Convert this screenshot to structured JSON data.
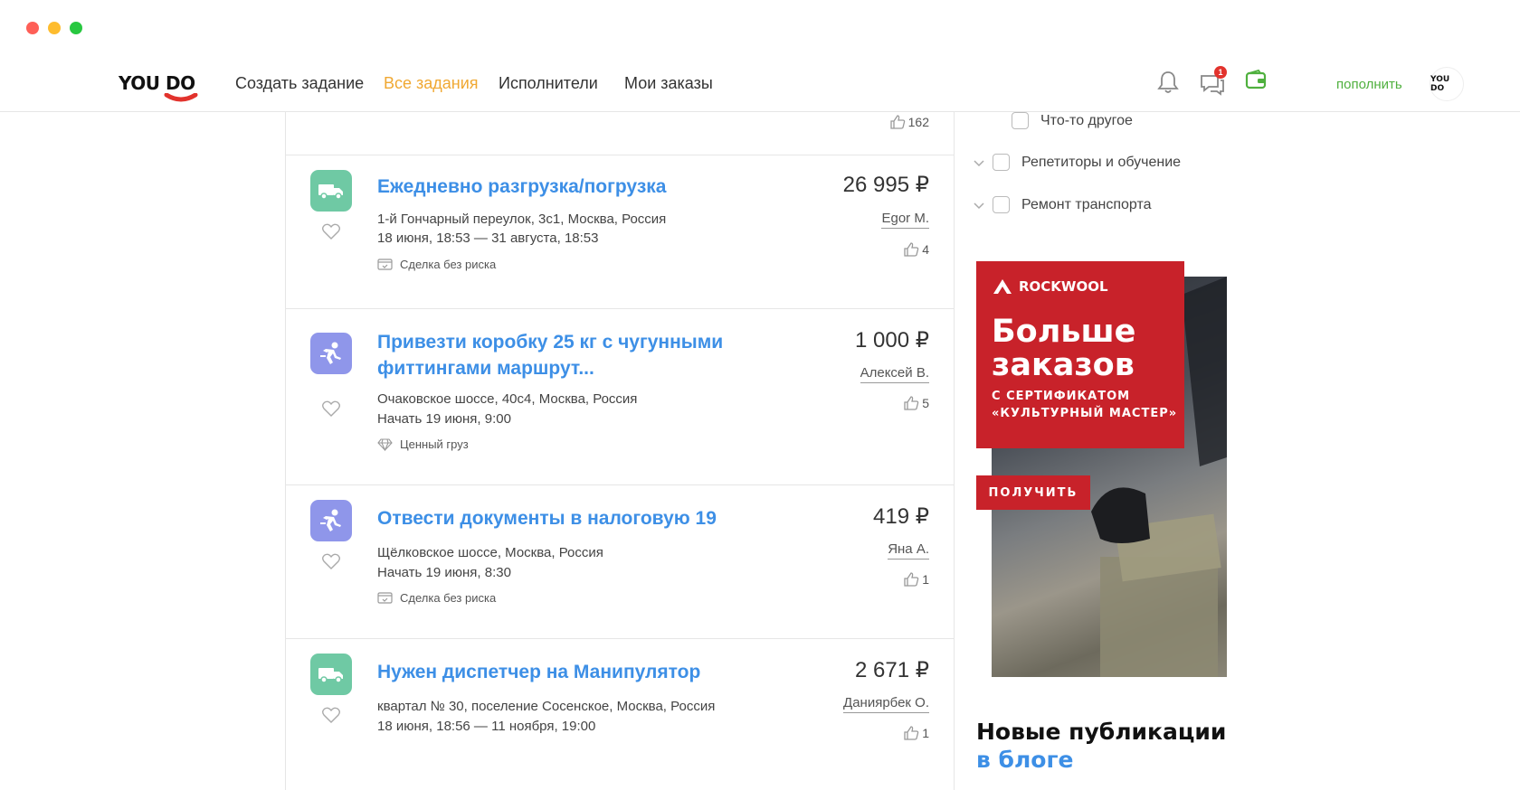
{
  "brand": {
    "logo_text": "YOU DO"
  },
  "nav": {
    "create": "Создать задание",
    "all_tasks": "Все задания",
    "executors": "Исполнители",
    "my_orders": "Мои заказы"
  },
  "header": {
    "messages_badge": "1",
    "topup_label": "пополнить",
    "avatar_text": "YOU DO"
  },
  "colors": {
    "accent": "#f0a832",
    "link": "#3d8fe6",
    "green": "#4fb03e",
    "ad_red": "#c8222a"
  },
  "prev_task": {
    "likes": "162"
  },
  "tasks": [
    {
      "category_icon": "truck-icon",
      "title": "Ежедневно разгрузка/погрузка",
      "address": "1-й Гончарный переулок, 3с1, Москва, Россия",
      "date": "18 июня, 18:53 — 31 августа, 18:53",
      "tag_icon": "safe-deal-icon",
      "tag": "Сделка без риска",
      "price": "26 995 ₽",
      "customer": "Egor M.",
      "likes": "4"
    },
    {
      "category_icon": "courier-icon",
      "title": "Привезти коробку 25 кг с чугунными фиттингами маршрут...",
      "address": "Очаковское шоссе, 40с4, Москва, Россия",
      "date": "Начать 19 июня, 9:00",
      "tag_icon": "diamond-icon",
      "tag": "Ценный груз",
      "price": "1 000 ₽",
      "customer": "Алексей В.",
      "likes": "5"
    },
    {
      "category_icon": "courier-icon",
      "title": "Отвести документы в налоговую 19",
      "address": "Щёлковское шоссе, Москва, Россия",
      "date": "Начать 19 июня, 8:30",
      "tag_icon": "safe-deal-icon",
      "tag": "Сделка без риска",
      "price": "419 ₽",
      "customer": "Яна А.",
      "likes": "1"
    },
    {
      "category_icon": "truck-icon",
      "title": "Нужен диспетчер на Манипулятор",
      "address": "квартал № 30, поселение Сосенское, Москва, Россия",
      "date": "18 июня, 18:56 — 11 ноября, 19:00",
      "price": "2 671 ₽",
      "customer": "Даниярбек О.",
      "likes": "1"
    }
  ],
  "filters": {
    "other": "Что-то другое",
    "tutors": "Репетиторы и обучение",
    "transport_repair": "Ремонт транспорта"
  },
  "ad": {
    "brand": "ROCKWOOL",
    "headline_1": "Больше",
    "headline_2": "заказов",
    "sub_1": "С СЕРТИФИКАТОМ",
    "sub_2": "«КУЛЬТУРНЫЙ МАСТЕР»",
    "button": "ПОЛУЧИТЬ"
  },
  "blog": {
    "title": "Новые публикации",
    "link": "в блоге"
  }
}
